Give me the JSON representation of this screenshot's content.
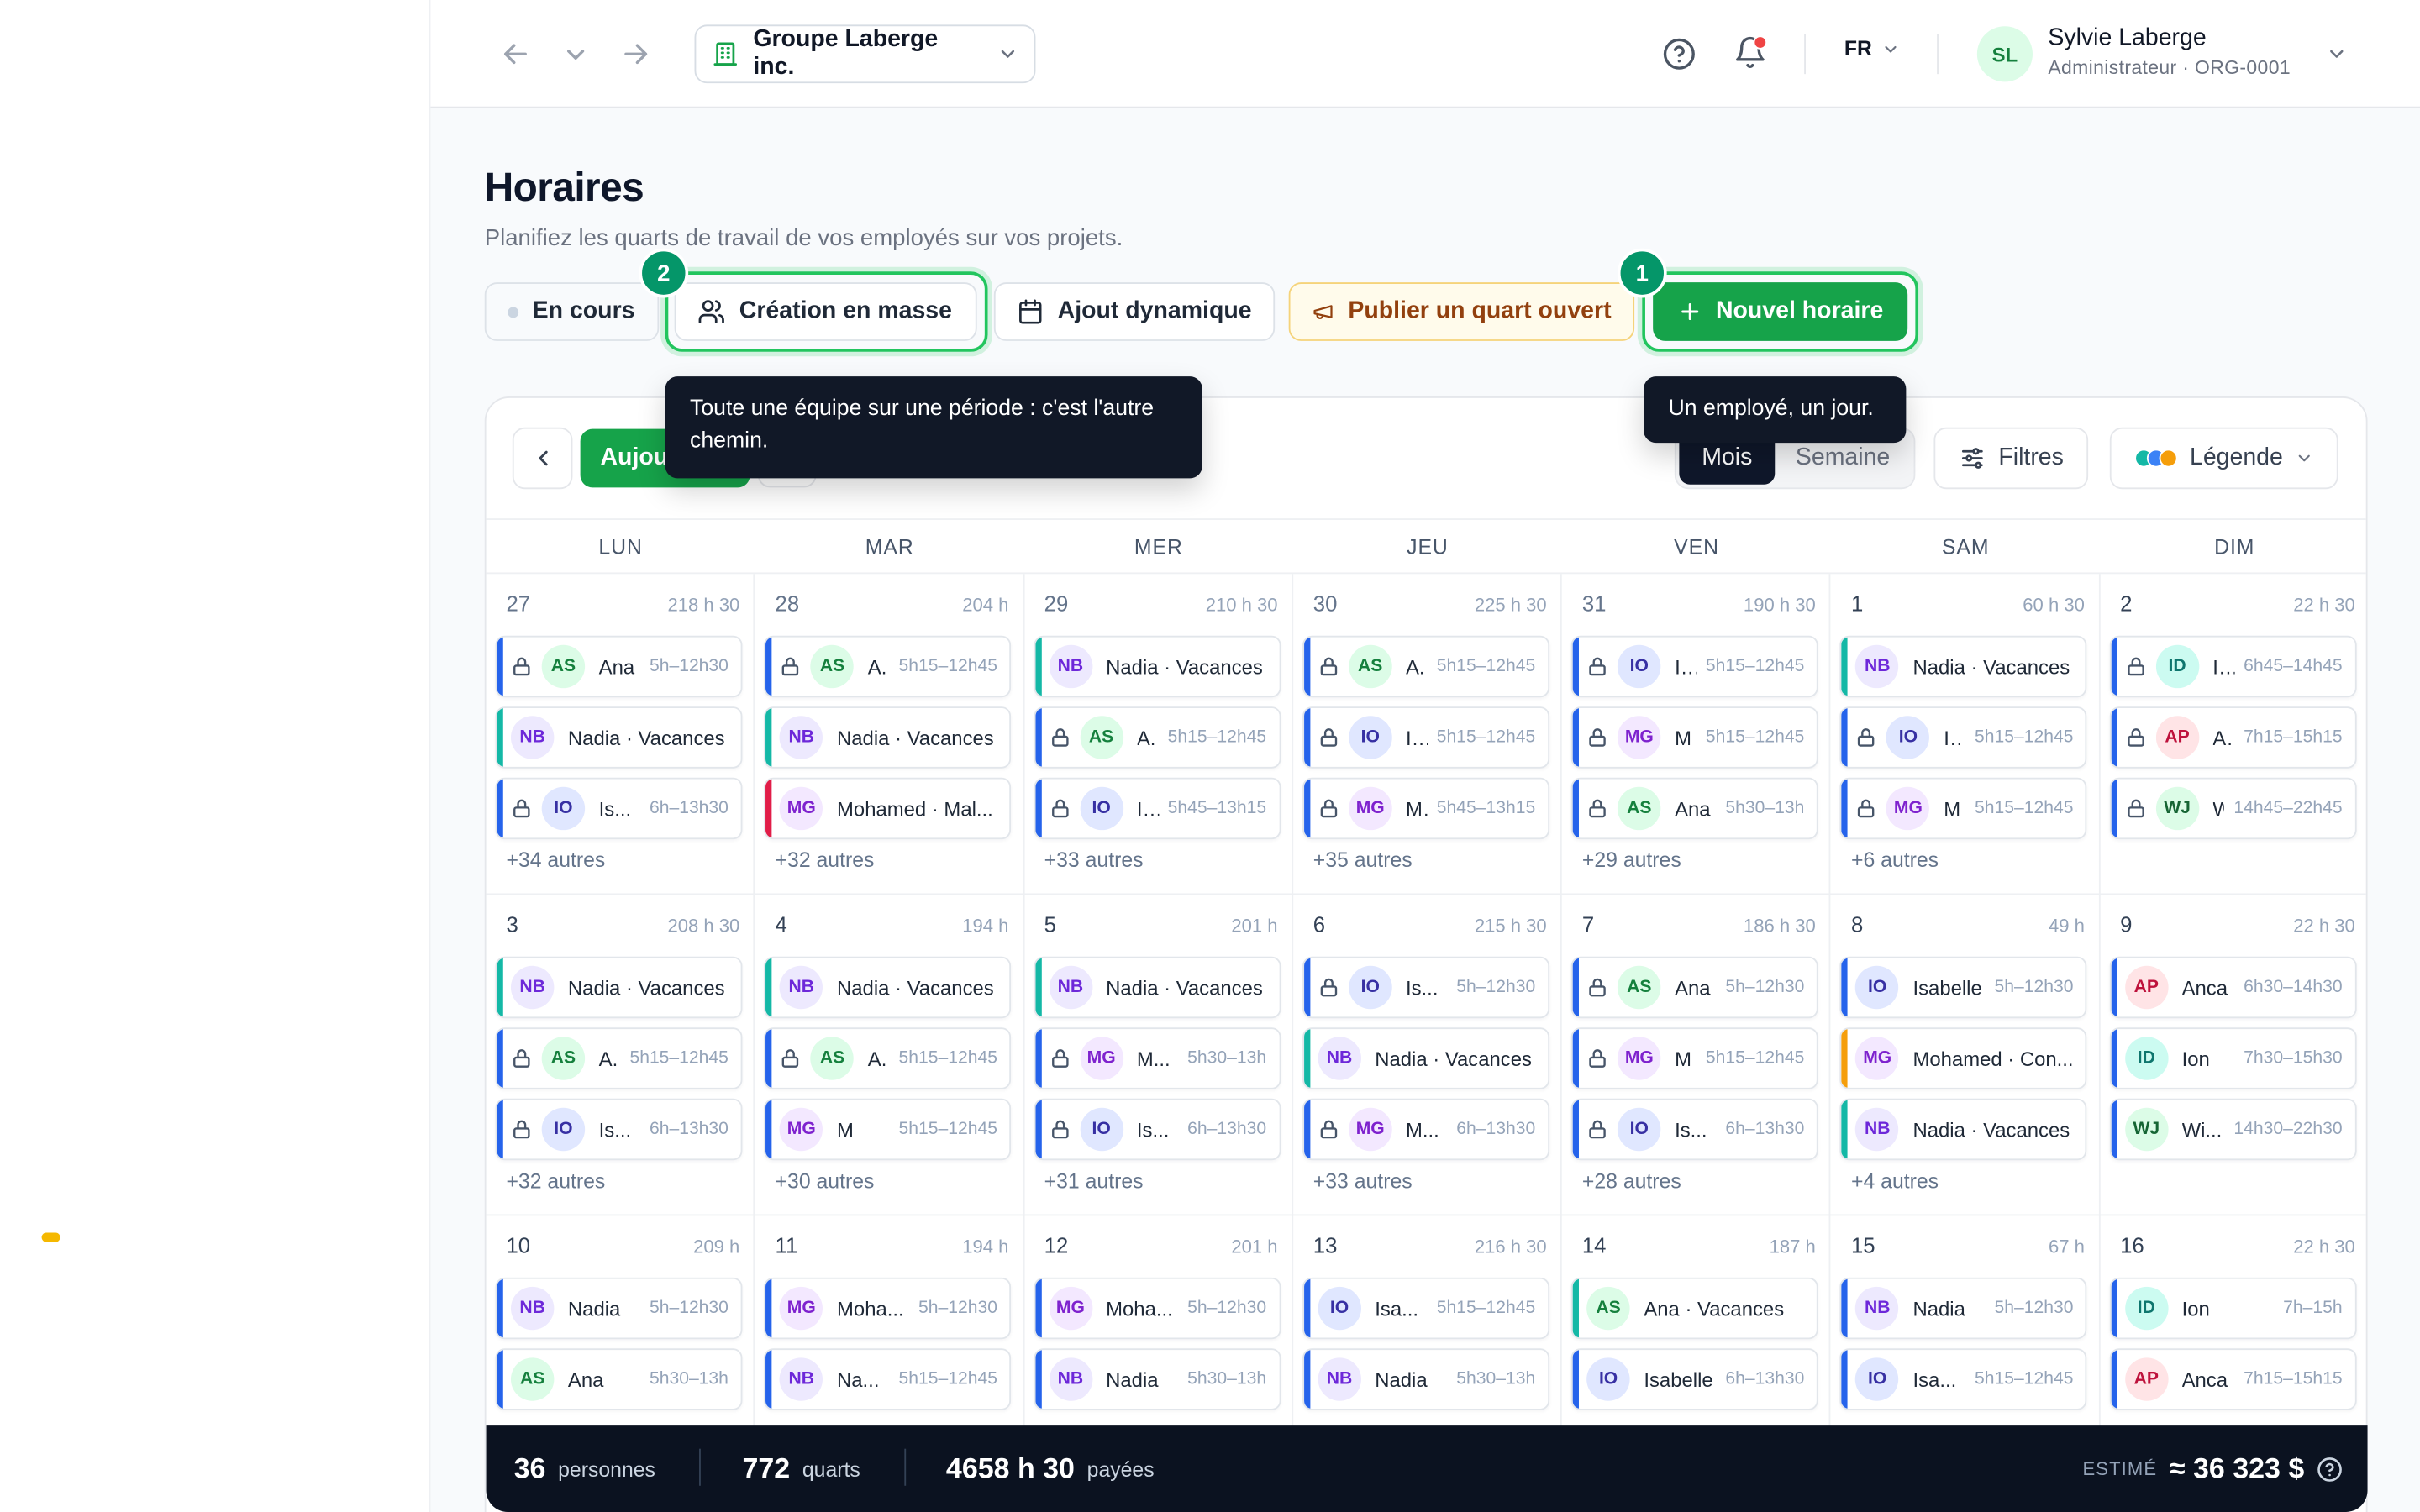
{
  "header": {
    "org_name": "Groupe Laberge inc.",
    "language": "FR",
    "user": {
      "initials": "SL",
      "name": "Sylvie Laberge",
      "role": "Administrateur · ORG-0001"
    }
  },
  "page": {
    "title": "Horaires",
    "subtitle": "Planifiez les quarts de travail de vos employés sur vos projets."
  },
  "actions": {
    "status_label": "En cours",
    "mass_label": "Création en masse",
    "dynamic_label": "Ajout dynamique",
    "publish_label": "Publier un quart ouvert",
    "new_label": "Nouvel horaire",
    "step_mass": "2",
    "step_new": "1",
    "tooltip_mass": "Toute une équipe sur une période : c'est l'autre chemin.",
    "tooltip_new": "Un employé, un jour."
  },
  "calendar": {
    "today_label": "Aujourd'hui",
    "view_month": "Mois",
    "view_week": "Semaine",
    "filters_label": "Filtres",
    "legend_label": "Légende",
    "legend_colors": [
      "#14b8a6",
      "#3b82f6",
      "#f59e0b"
    ],
    "days_of_week": [
      "LUN",
      "MAR",
      "MER",
      "JEU",
      "VEN",
      "SAM",
      "DIM"
    ],
    "weeks": [
      [
        {
          "num": "27",
          "hours": "218 h 30",
          "past": true,
          "more": "+34 autres",
          "shifts": [
            {
              "lock": true,
              "initials": "AS",
              "name": "Ana",
              "time": "5h–12h30",
              "bar": "#2563eb"
            },
            {
              "lock": false,
              "initials": "NB",
              "name": "Nadia · Vacances",
              "time": "",
              "bar": "#14b8a6"
            },
            {
              "lock": true,
              "initials": "IO",
              "name": "Is...",
              "time": "6h–13h30",
              "bar": "#2563eb"
            }
          ]
        },
        {
          "num": "28",
          "hours": "204 h",
          "past": true,
          "more": "+32 autres",
          "shifts": [
            {
              "lock": true,
              "initials": "AS",
              "name": "A.",
              "time": "5h15–12h45",
              "bar": "#2563eb"
            },
            {
              "lock": false,
              "initials": "NB",
              "name": "Nadia · Vacances",
              "time": "",
              "bar": "#14b8a6"
            },
            {
              "lock": false,
              "initials": "MG",
              "name": "Mohamed · Mal...",
              "time": "",
              "bar": "#e11d48"
            }
          ]
        },
        {
          "num": "29",
          "hours": "210 h 30",
          "past": true,
          "more": "+33 autres",
          "shifts": [
            {
              "lock": false,
              "initials": "NB",
              "name": "Nadia · Vacances",
              "time": "",
              "bar": "#14b8a6"
            },
            {
              "lock": true,
              "initials": "AS",
              "name": "A.",
              "time": "5h15–12h45",
              "bar": "#2563eb"
            },
            {
              "lock": true,
              "initials": "IO",
              "name": "I...",
              "time": "5h45–13h15",
              "bar": "#2563eb"
            }
          ]
        },
        {
          "num": "30",
          "hours": "225 h 30",
          "past": true,
          "more": "+35 autres",
          "shifts": [
            {
              "lock": true,
              "initials": "AS",
              "name": "A.",
              "time": "5h15–12h45",
              "bar": "#2563eb"
            },
            {
              "lock": true,
              "initials": "IO",
              "name": "I...",
              "time": "5h15–12h45",
              "bar": "#2563eb"
            },
            {
              "lock": true,
              "initials": "MG",
              "name": "M.",
              "time": "5h45–13h15",
              "bar": "#2563eb"
            }
          ]
        },
        {
          "num": "31",
          "hours": "190 h 30",
          "past": true,
          "more": "+29 autres",
          "shifts": [
            {
              "lock": true,
              "initials": "IO",
              "name": "I...",
              "time": "5h15–12h45",
              "bar": "#2563eb"
            },
            {
              "lock": true,
              "initials": "MG",
              "name": "M",
              "time": "5h15–12h45",
              "bar": "#2563eb"
            },
            {
              "lock": true,
              "initials": "AS",
              "name": "Ana",
              "time": "5h30–13h",
              "bar": "#2563eb"
            }
          ]
        },
        {
          "num": "1",
          "hours": "60 h 30",
          "past": false,
          "more": "+6 autres",
          "shifts": [
            {
              "lock": false,
              "initials": "NB",
              "name": "Nadia · Vacances",
              "time": "",
              "bar": "#14b8a6"
            },
            {
              "lock": true,
              "initials": "IO",
              "name": "I...",
              "time": "5h15–12h45",
              "bar": "#2563eb"
            },
            {
              "lock": true,
              "initials": "MG",
              "name": "M",
              "time": "5h15–12h45",
              "bar": "#2563eb"
            }
          ]
        },
        {
          "num": "2",
          "hours": "22 h 30",
          "past": false,
          "more": "",
          "shifts": [
            {
              "lock": true,
              "initials": "ID",
              "name": "I...",
              "time": "6h45–14h45",
              "bar": "#2563eb"
            },
            {
              "lock": true,
              "initials": "AP",
              "name": "A..",
              "time": "7h15–15h15",
              "bar": "#2563eb"
            },
            {
              "lock": true,
              "initials": "WJ",
              "name": "W",
              "time": "14h45–22h45",
              "bar": "#2563eb"
            }
          ]
        }
      ],
      [
        {
          "num": "3",
          "hours": "208 h 30",
          "past": false,
          "more": "+32 autres",
          "shifts": [
            {
              "lock": false,
              "initials": "NB",
              "name": "Nadia · Vacances",
              "time": "",
              "bar": "#14b8a6"
            },
            {
              "lock": true,
              "initials": "AS",
              "name": "A.",
              "time": "5h15–12h45",
              "bar": "#2563eb"
            },
            {
              "lock": true,
              "initials": "IO",
              "name": "Is...",
              "time": "6h–13h30",
              "bar": "#2563eb"
            }
          ]
        },
        {
          "num": "4",
          "hours": "194 h",
          "past": false,
          "more": "+30 autres",
          "shifts": [
            {
              "lock": false,
              "initials": "NB",
              "name": "Nadia · Vacances",
              "time": "",
              "bar": "#14b8a6"
            },
            {
              "lock": true,
              "initials": "AS",
              "name": "A.",
              "time": "5h15–12h45",
              "bar": "#2563eb"
            },
            {
              "lock": false,
              "initials": "MG",
              "name": "M",
              "time": "5h15–12h45",
              "bar": "#2563eb"
            }
          ]
        },
        {
          "num": "5",
          "hours": "201 h",
          "past": false,
          "more": "+31 autres",
          "shifts": [
            {
              "lock": false,
              "initials": "NB",
              "name": "Nadia · Vacances",
              "time": "",
              "bar": "#14b8a6"
            },
            {
              "lock": true,
              "initials": "MG",
              "name": "M...",
              "time": "5h30–13h",
              "bar": "#2563eb"
            },
            {
              "lock": true,
              "initials": "IO",
              "name": "Is...",
              "time": "6h–13h30",
              "bar": "#2563eb"
            }
          ]
        },
        {
          "num": "6",
          "hours": "215 h 30",
          "past": false,
          "more": "+33 autres",
          "shifts": [
            {
              "lock": true,
              "initials": "IO",
              "name": "Is...",
              "time": "5h–12h30",
              "bar": "#2563eb"
            },
            {
              "lock": false,
              "initials": "NB",
              "name": "Nadia · Vacances",
              "time": "",
              "bar": "#14b8a6"
            },
            {
              "lock": true,
              "initials": "MG",
              "name": "M...",
              "time": "6h–13h30",
              "bar": "#2563eb"
            }
          ]
        },
        {
          "num": "7",
          "hours": "186 h 30",
          "past": false,
          "more": "+28 autres",
          "shifts": [
            {
              "lock": true,
              "initials": "AS",
              "name": "Ana",
              "time": "5h–12h30",
              "bar": "#2563eb"
            },
            {
              "lock": true,
              "initials": "MG",
              "name": "M",
              "time": "5h15–12h45",
              "bar": "#2563eb"
            },
            {
              "lock": true,
              "initials": "IO",
              "name": "Is...",
              "time": "6h–13h30",
              "bar": "#2563eb"
            }
          ]
        },
        {
          "num": "8",
          "hours": "49 h",
          "past": false,
          "more": "+4 autres",
          "shifts": [
            {
              "lock": false,
              "initials": "IO",
              "name": "Isabelle",
              "time": "5h–12h30",
              "bar": "#2563eb"
            },
            {
              "lock": false,
              "initials": "MG",
              "name": "Mohamed · Con...",
              "time": "",
              "bar": "#f59e0b"
            },
            {
              "lock": false,
              "initials": "NB",
              "name": "Nadia · Vacances",
              "time": "",
              "bar": "#14b8a6"
            }
          ]
        },
        {
          "num": "9",
          "hours": "22 h 30",
          "past": false,
          "more": "",
          "shifts": [
            {
              "lock": false,
              "initials": "AP",
              "name": "Anca",
              "time": "6h30–14h30",
              "bar": "#2563eb"
            },
            {
              "lock": false,
              "initials": "ID",
              "name": "Ion",
              "time": "7h30–15h30",
              "bar": "#2563eb"
            },
            {
              "lock": false,
              "initials": "WJ",
              "name": "Wi...",
              "time": "14h30–22h30",
              "bar": "#2563eb"
            }
          ]
        }
      ],
      [
        {
          "num": "10",
          "hours": "209 h",
          "past": false,
          "more": "",
          "shifts": [
            {
              "lock": false,
              "initials": "NB",
              "name": "Nadia",
              "time": "5h–12h30",
              "bar": "#2563eb"
            },
            {
              "lock": false,
              "initials": "AS",
              "name": "Ana",
              "time": "5h30–13h",
              "bar": "#2563eb"
            }
          ]
        },
        {
          "num": "11",
          "hours": "194 h",
          "past": false,
          "more": "",
          "shifts": [
            {
              "lock": false,
              "initials": "MG",
              "name": "Moha...",
              "time": "5h–12h30",
              "bar": "#2563eb"
            },
            {
              "lock": false,
              "initials": "NB",
              "name": "Na...",
              "time": "5h15–12h45",
              "bar": "#2563eb"
            }
          ]
        },
        {
          "num": "12",
          "hours": "201 h",
          "past": false,
          "more": "",
          "shifts": [
            {
              "lock": false,
              "initials": "MG",
              "name": "Moha...",
              "time": "5h–12h30",
              "bar": "#2563eb"
            },
            {
              "lock": false,
              "initials": "NB",
              "name": "Nadia",
              "time": "5h30–13h",
              "bar": "#2563eb"
            }
          ]
        },
        {
          "num": "13",
          "hours": "216 h 30",
          "past": false,
          "more": "",
          "shifts": [
            {
              "lock": false,
              "initials": "IO",
              "name": "Isa...",
              "time": "5h15–12h45",
              "bar": "#2563eb"
            },
            {
              "lock": false,
              "initials": "NB",
              "name": "Nadia",
              "time": "5h30–13h",
              "bar": "#2563eb"
            }
          ]
        },
        {
          "num": "14",
          "hours": "187 h",
          "past": false,
          "more": "",
          "shifts": [
            {
              "lock": false,
              "initials": "AS",
              "name": "Ana · Vacances",
              "time": "",
              "bar": "#14b8a6"
            },
            {
              "lock": false,
              "initials": "IO",
              "name": "Isabelle",
              "time": "6h–13h30",
              "bar": "#2563eb"
            }
          ]
        },
        {
          "num": "15",
          "hours": "67 h",
          "past": false,
          "more": "",
          "shifts": [
            {
              "lock": false,
              "initials": "NB",
              "name": "Nadia",
              "time": "5h–12h30",
              "bar": "#2563eb"
            },
            {
              "lock": false,
              "initials": "IO",
              "name": "Isa...",
              "time": "5h15–12h45",
              "bar": "#2563eb"
            }
          ]
        },
        {
          "num": "16",
          "hours": "22 h 30",
          "past": false,
          "more": "",
          "shifts": [
            {
              "lock": false,
              "initials": "ID",
              "name": "Ion",
              "time": "7h–15h",
              "bar": "#2563eb"
            },
            {
              "lock": false,
              "initials": "AP",
              "name": "Anca",
              "time": "7h15–15h15",
              "bar": "#2563eb"
            }
          ]
        }
      ]
    ]
  },
  "avatar_colors": {
    "AS": {
      "bg": "#dcfce7",
      "fg": "#15803d"
    },
    "NB": {
      "bg": "#ede9fe",
      "fg": "#6d28d9"
    },
    "IO": {
      "bg": "#e0e7ff",
      "fg": "#3730a3"
    },
    "MG": {
      "bg": "#f3e8ff",
      "fg": "#7e22ce"
    },
    "ID": {
      "bg": "#ccfbf1",
      "fg": "#0f766e"
    },
    "AP": {
      "bg": "#ffe4e6",
      "fg": "#be123c"
    },
    "WJ": {
      "bg": "#dcfce7",
      "fg": "#166534"
    }
  },
  "footer": {
    "people_count": "36",
    "people_label": "personnes",
    "shifts_count": "772",
    "shifts_label": "quarts",
    "paid_hours": "4658 h 30",
    "paid_label": "payées",
    "estimate_label": "ESTIMÉ",
    "estimate_value": "≈ 36 323 $"
  }
}
